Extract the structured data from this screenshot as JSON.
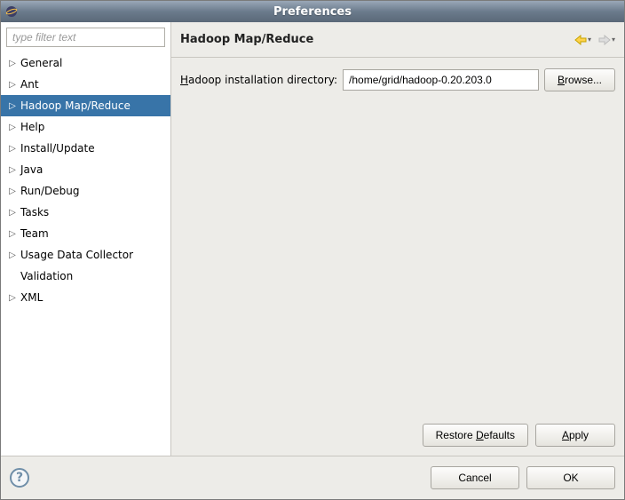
{
  "window": {
    "title": "Preferences"
  },
  "filter": {
    "placeholder": "type filter text"
  },
  "tree": {
    "items": [
      {
        "label": "General",
        "expandable": true,
        "selected": false
      },
      {
        "label": "Ant",
        "expandable": true,
        "selected": false
      },
      {
        "label": "Hadoop Map/Reduce",
        "expandable": true,
        "selected": true
      },
      {
        "label": "Help",
        "expandable": true,
        "selected": false
      },
      {
        "label": "Install/Update",
        "expandable": true,
        "selected": false
      },
      {
        "label": "Java",
        "expandable": true,
        "selected": false
      },
      {
        "label": "Run/Debug",
        "expandable": true,
        "selected": false
      },
      {
        "label": "Tasks",
        "expandable": true,
        "selected": false
      },
      {
        "label": "Team",
        "expandable": true,
        "selected": false
      },
      {
        "label": "Usage Data Collector",
        "expandable": true,
        "selected": false
      },
      {
        "label": "Validation",
        "expandable": false,
        "selected": false
      },
      {
        "label": "XML",
        "expandable": true,
        "selected": false
      }
    ]
  },
  "page": {
    "title": "Hadoop Map/Reduce",
    "install_label_pre": "H",
    "install_label_post": "adoop installation directory:",
    "install_value": "/home/grid/hadoop-0.20.203.0",
    "browse_pre": "B",
    "browse_post": "rowse...",
    "restore_pre": "Restore ",
    "restore_u": "D",
    "restore_post": "efaults",
    "apply_pre": "",
    "apply_u": "A",
    "apply_post": "pply"
  },
  "footer": {
    "cancel": "Cancel",
    "ok": "OK",
    "help": "?"
  }
}
